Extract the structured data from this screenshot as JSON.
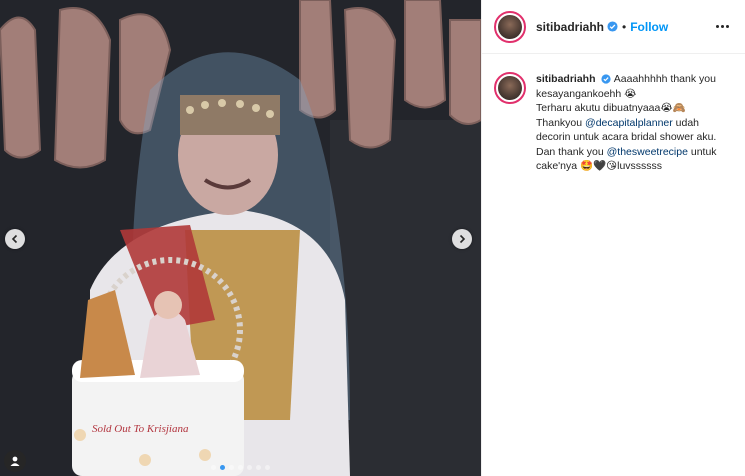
{
  "account": {
    "username": "sitibadriahh",
    "follow_label": "Follow",
    "separator": "•"
  },
  "caption": {
    "username": "sitibadriahh",
    "line1": "Aaaahhhhh thank you kesayangankoehh 😭",
    "line2": "Terharu akutu dibuatnyaaa😭🙈",
    "line3_prefix": "Thankyou ",
    "mention1": "@decapitalplanner",
    "line3_suffix": " udah decorin untuk acara bridal shower aku.",
    "line4_prefix": "Dan thank you ",
    "mention2": "@thesweetrecipe",
    "line4_suffix": " untuk cake'nya 🤩🖤😘luvssssss"
  },
  "media": {
    "cake_text": "Sold Out To Krisjiana",
    "carousel_count": 7,
    "carousel_active_index": 1
  },
  "colors": {
    "link": "#0095f6",
    "mention": "#00376b",
    "verified": "#3897f0",
    "avatar_ring": "#e1306c"
  },
  "icons": {
    "prev": "chevron-left-icon",
    "next": "chevron-right-icon",
    "verified": "verified-badge-icon",
    "more": "more-options-icon",
    "user_tag": "user-tag-icon"
  }
}
